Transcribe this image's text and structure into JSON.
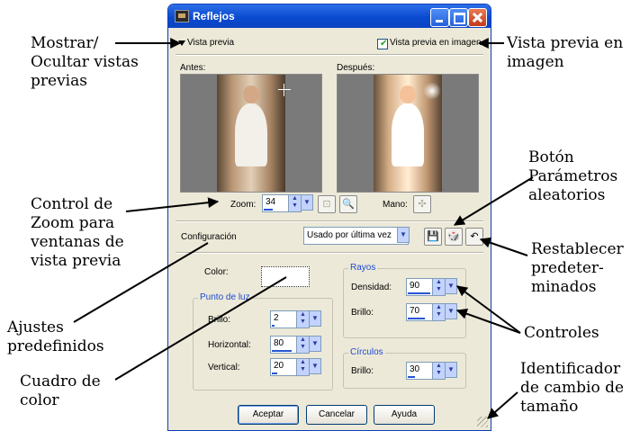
{
  "window": {
    "title": "Reflejos"
  },
  "top_row": {
    "show_previews_label": "Vista previa",
    "image_preview_label": "Vista previa en imagen"
  },
  "previews": {
    "before_label": "Antes:",
    "after_label": "Después:"
  },
  "zoom": {
    "label": "Zoom:",
    "value": "34",
    "hand_label": "Mano:"
  },
  "preset": {
    "label": "Configuración",
    "selected": "Usado por última vez"
  },
  "color": {
    "label": "Color:"
  },
  "punto_de_luz": {
    "title": "Punto de luz",
    "brillo_label": "Brillo:",
    "brillo_value": "2",
    "horizontal_label": "Horizontal:",
    "horizontal_value": "80",
    "vertical_label": "Vertical:",
    "vertical_value": "20"
  },
  "rayos": {
    "title": "Rayos",
    "densidad_label": "Densidad:",
    "densidad_value": "90",
    "brillo_label": "Brillo:",
    "brillo_value": "70"
  },
  "circulos": {
    "title": "Círculos",
    "brillo_label": "Brillo:",
    "brillo_value": "30"
  },
  "buttons": {
    "accept": "Aceptar",
    "cancel": "Cancelar",
    "help": "Ayuda"
  },
  "callouts": {
    "show_hide": "Mostrar/\nOcultar vistas\nprevias",
    "image_preview": "Vista previa en\nimagen",
    "random_params": "Botón\nParámetros\naleatorios",
    "zoom_control": "Control de\nZoom para\nventanas de\nvista previa",
    "restore_defaults": "Restablecer\npredeter-\nminados",
    "presets": "Ajustes\npredefinidos",
    "controls": "Controles",
    "color_box": "Cuadro de\ncolor",
    "resize_id": "Identificador\nde cambio de\ntamaño"
  },
  "colors": {
    "title_bar": "#0a4ad0",
    "dialog_bg": "#ece9d8",
    "group_title": "#1f4bd0"
  }
}
